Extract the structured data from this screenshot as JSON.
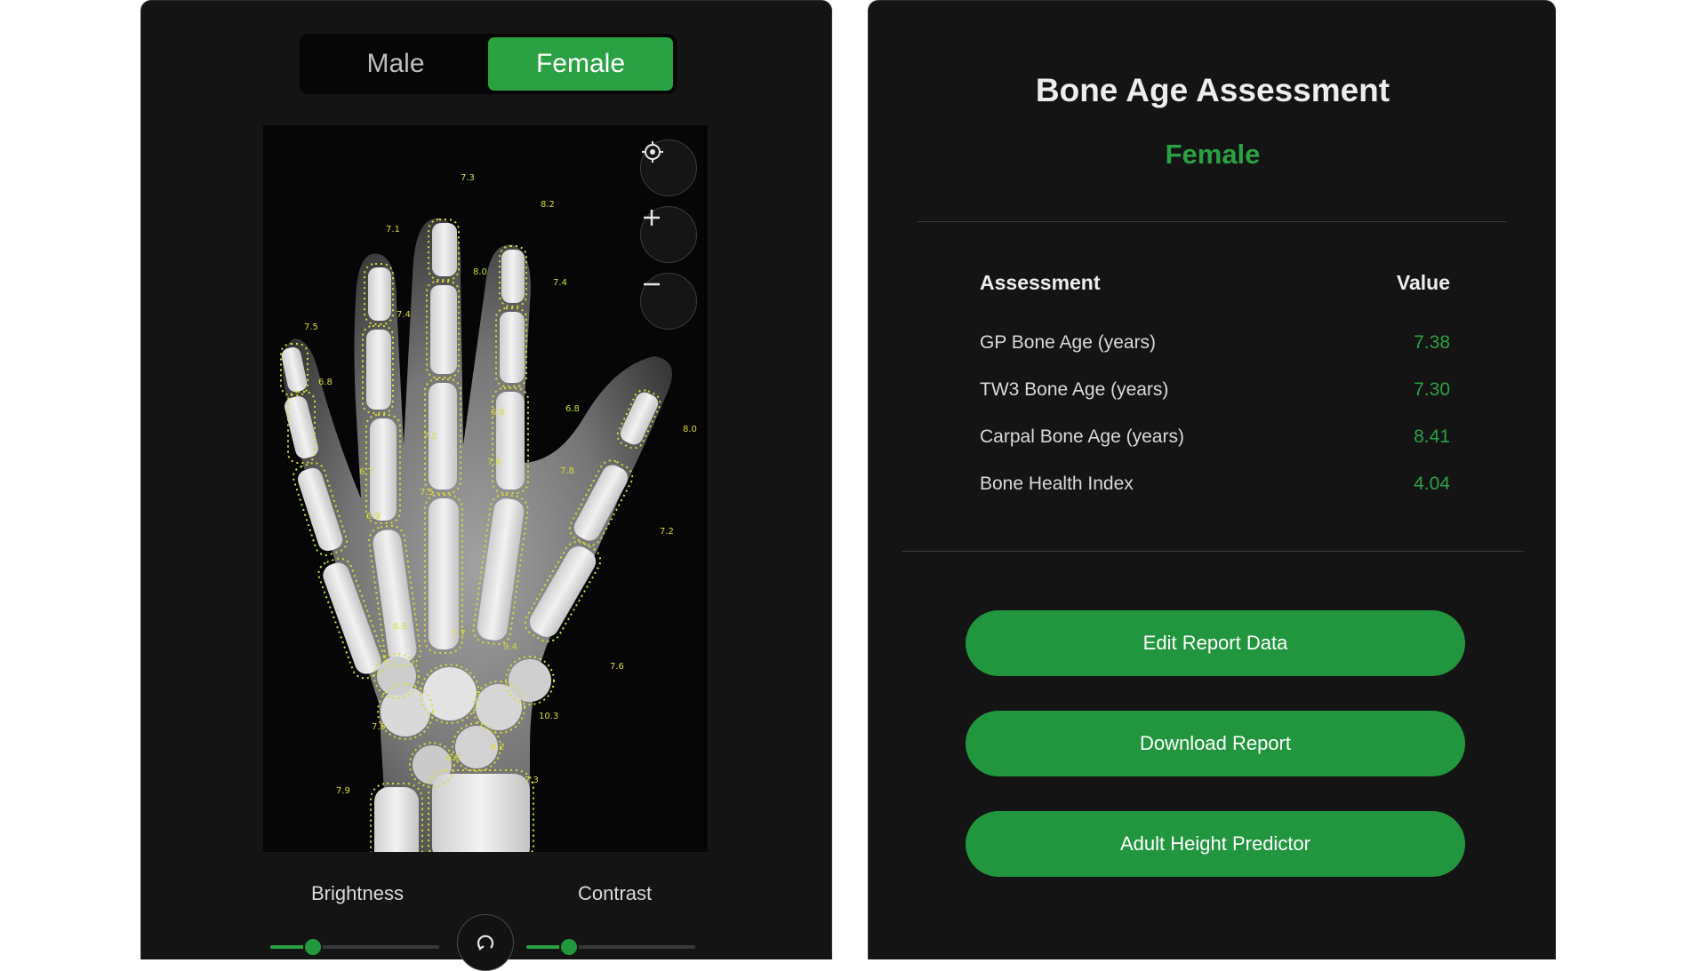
{
  "gender_toggle": {
    "male_label": "Male",
    "female_label": "Female",
    "selected": "Female"
  },
  "viewer": {
    "tools": [
      "target-icon",
      "zoom-in-icon",
      "zoom-out-icon"
    ],
    "annotations": [
      "7.3",
      "7.1",
      "8.2",
      "8.0",
      "7.4",
      "7.4",
      "7.5",
      "6.8",
      "6.8",
      "6.8",
      "8.0",
      "7.2",
      "6.7",
      "7.6",
      "7.8",
      "6.9",
      "7.5",
      "7.2",
      "6.9",
      "7.7",
      "9.4",
      "7.6",
      "10.3",
      "7.5",
      "6.8",
      "8.2",
      "7.3",
      "7.9"
    ]
  },
  "controls": {
    "brightness_label": "Brightness",
    "contrast_label": "Contrast",
    "brightness_value": 0.25,
    "contrast_value": 0.25
  },
  "report": {
    "title": "Bone Age Assessment",
    "gender": "Female",
    "table": {
      "header_assessment": "Assessment",
      "header_value": "Value",
      "rows": [
        {
          "label": "GP Bone Age (years)",
          "value": "7.38"
        },
        {
          "label": "TW3 Bone Age (years)",
          "value": "7.30"
        },
        {
          "label": "Carpal Bone Age (years)",
          "value": "8.41"
        },
        {
          "label": "Bone Health Index",
          "value": "4.04"
        }
      ]
    },
    "buttons": {
      "edit": "Edit Report Data",
      "download": "Download Report",
      "height": "Adult Height Predictor"
    }
  },
  "colors": {
    "accent": "#2aa143",
    "panel": "#141414",
    "annotation": "#d7dc35"
  }
}
